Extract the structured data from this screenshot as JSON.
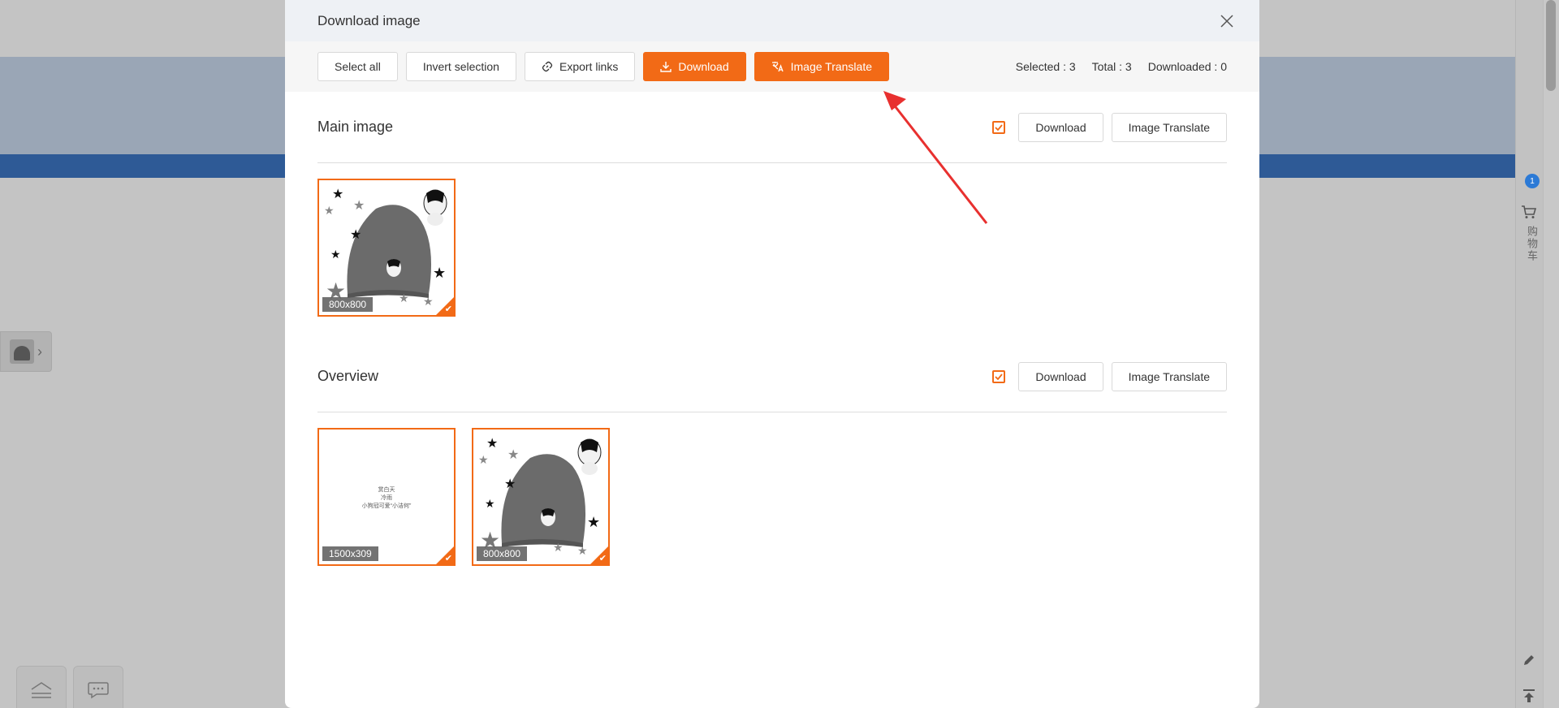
{
  "modal": {
    "title": "Download image",
    "toolbar": {
      "select_all": "Select all",
      "invert_selection": "Invert selection",
      "export_links": "Export links",
      "download": "Download",
      "image_translate": "Image Translate"
    },
    "stats": {
      "selected": "Selected : 3",
      "total": "Total : 3",
      "downloaded": "Downloaded : 0"
    },
    "sections": [
      {
        "title": "Main image",
        "download_label": "Download",
        "translate_label": "Image Translate",
        "checked": true,
        "images": [
          {
            "size": "800x800",
            "kind": "hat-photo",
            "selected": true
          }
        ]
      },
      {
        "title": "Overview",
        "download_label": "Download",
        "translate_label": "Image Translate",
        "checked": true,
        "images": [
          {
            "size": "1500x309",
            "kind": "text-banner",
            "selected": true,
            "lines": [
              "赏白天",
              "冷雨",
              "小狗冠可爱“小洁何”"
            ]
          },
          {
            "size": "800x800",
            "kind": "hat-photo",
            "selected": true
          }
        ]
      }
    ]
  },
  "rail": {
    "badge": "1",
    "cart_label": "购物车"
  },
  "colors": {
    "accent": "#f26a16",
    "annotation_arrow": "#e8302f"
  }
}
